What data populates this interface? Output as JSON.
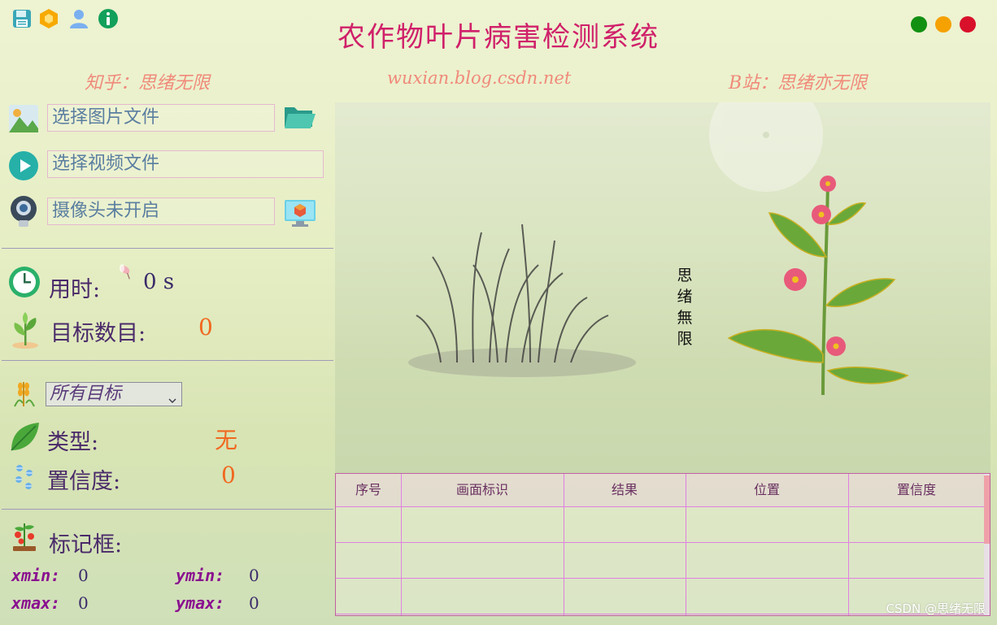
{
  "title": "农作物叶片病害检测系统",
  "subtitles": {
    "zhihu": "知乎：思绪无限",
    "blog": "wuxian.blog.csdn.net",
    "bilibili": "B站：思绪亦无限"
  },
  "inputs": {
    "image_file": "选择图片文件",
    "video_file": "选择视频文件",
    "camera": "摄像头未开启"
  },
  "stats": {
    "time_label": "用时:",
    "time_value": "0 s",
    "count_label": "目标数目:",
    "count_value": "0"
  },
  "filter": {
    "selected": "所有目标"
  },
  "result": {
    "type_label": "类型:",
    "type_value": "无",
    "conf_label": "置信度:",
    "conf_value": "0"
  },
  "bbox": {
    "label": "标记框:",
    "xmin_label": "xmin:",
    "xmin": "0",
    "ymin_label": "ymin:",
    "ymin": "0",
    "xmax_label": "xmax:",
    "xmax": "0",
    "ymax_label": "ymax:",
    "ymax": "0"
  },
  "image_caption": [
    "思",
    "绪",
    "無",
    "限"
  ],
  "table": {
    "columns": [
      "序号",
      "画面标识",
      "结果",
      "位置",
      "置信度"
    ]
  },
  "watermark": "CSDN @思绪无限",
  "colors": {
    "title": "#d0206a",
    "accent_orange": "#f06820",
    "win_green": "#129012",
    "win_yellow": "#f5a100",
    "win_red": "#d8102a"
  },
  "icons": [
    "save-icon",
    "hexagon-icon",
    "user-icon",
    "info-icon",
    "image-icon",
    "folder-open-icon",
    "play-icon",
    "webcam-icon",
    "monitor-cube-icon",
    "clock-icon",
    "sprout-icon",
    "wheat-icon",
    "leaf-icon",
    "snowflake-icon",
    "tomato-plant-icon"
  ]
}
